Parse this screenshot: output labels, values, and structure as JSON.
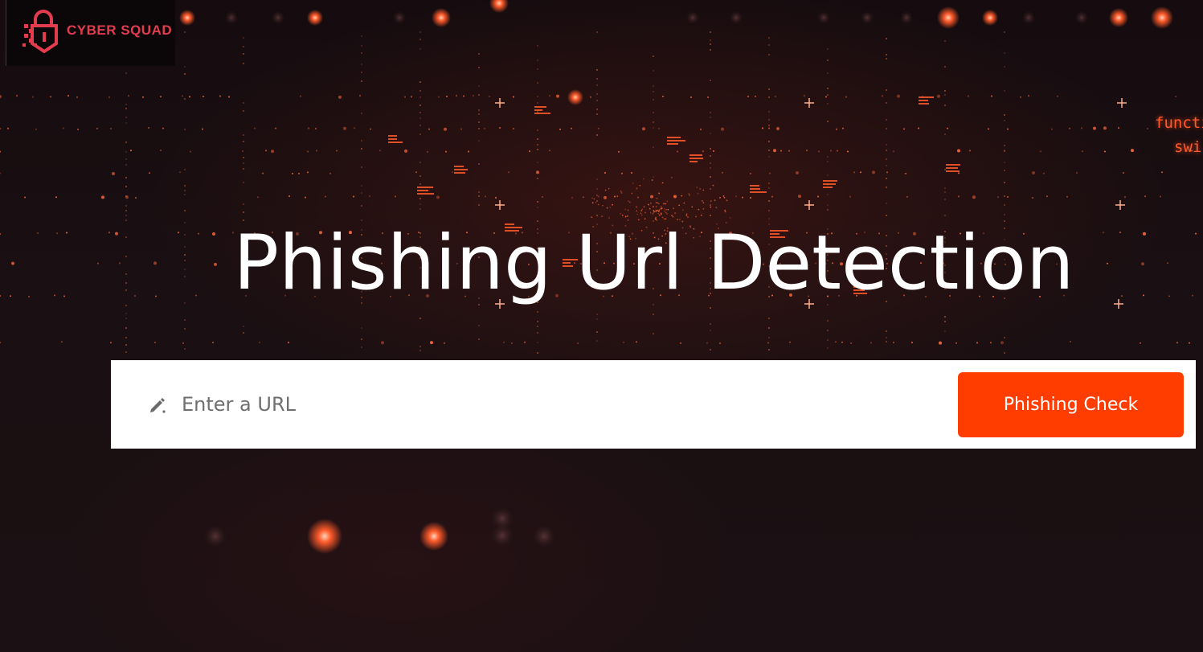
{
  "brand": {
    "logo_text": "CYBER SQUAD",
    "logo_icon": "padlock-icon",
    "logo_color": "#e43c4f"
  },
  "background": {
    "corner_code_lines": [
      "functi",
      "swi"
    ],
    "accent_color": "#ff5a2a"
  },
  "hero": {
    "title": "Phishing Url Detection"
  },
  "search": {
    "icon": "pencil-icon",
    "placeholder": "Enter a URL",
    "value": "",
    "button_label": "Phishing Check",
    "button_color": "#ff3d00"
  }
}
